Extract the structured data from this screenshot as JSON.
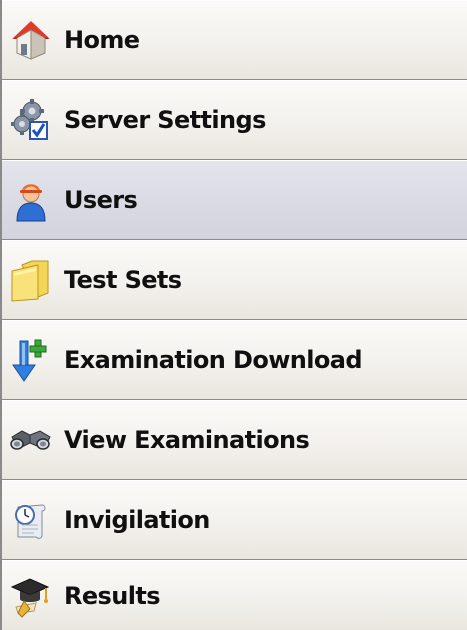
{
  "nav": {
    "items": [
      {
        "label": "Home",
        "icon": "home-icon"
      },
      {
        "label": "Server Settings",
        "icon": "server-settings-icon"
      },
      {
        "label": "Users",
        "icon": "user-icon",
        "selected": true
      },
      {
        "label": "Test Sets",
        "icon": "folder-icon"
      },
      {
        "label": "Examination Download",
        "icon": "download-icon"
      },
      {
        "label": "View Examinations",
        "icon": "binoculars-icon"
      },
      {
        "label": "Invigilation",
        "icon": "invigilation-icon"
      },
      {
        "label": "Results",
        "icon": "graduation-cap-icon"
      }
    ]
  },
  "colors": {
    "item_bg": "#f4f2ee",
    "selected_bg": "#dadbe4",
    "separator": "#8a8a8a",
    "text": "#101010"
  }
}
